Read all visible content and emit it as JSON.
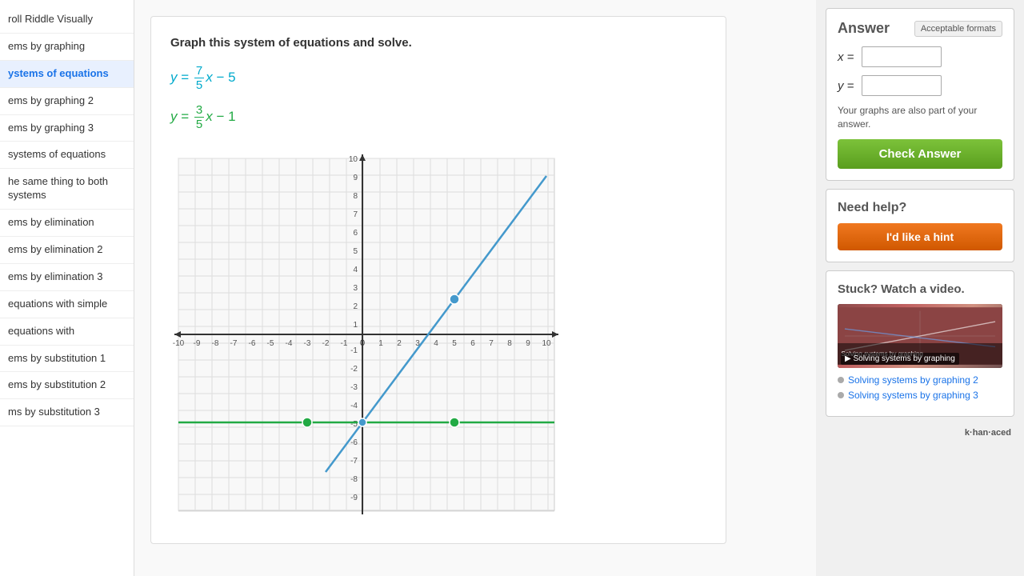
{
  "sidebar": {
    "items": [
      {
        "label": "roll Riddle Visually",
        "active": false
      },
      {
        "label": "ems by graphing",
        "active": false
      },
      {
        "label": "ystems of equations",
        "active": true
      },
      {
        "label": "ems by graphing 2",
        "active": false
      },
      {
        "label": "ems by graphing 3",
        "active": false
      },
      {
        "label": "systems of equations",
        "active": false
      },
      {
        "label": "he same thing to both systems",
        "active": false
      },
      {
        "label": "ems by elimination",
        "active": false
      },
      {
        "label": "ems by elimination 2",
        "active": false
      },
      {
        "label": "ems by elimination 3",
        "active": false
      },
      {
        "label": "equations with simple",
        "active": false
      },
      {
        "label": "equations with",
        "active": false
      },
      {
        "label": "ems by substitution 1",
        "active": false
      },
      {
        "label": "ems by substitution 2",
        "active": false
      },
      {
        "label": "ms by substitution 3",
        "active": false
      }
    ]
  },
  "problem": {
    "title": "Graph this system of equations and solve.",
    "eq1_prefix": "y =",
    "eq1_fraction_num": "7",
    "eq1_fraction_den": "5",
    "eq1_suffix": "x − 5",
    "eq2_prefix": "y =",
    "eq2_fraction_num": "3",
    "eq2_fraction_den": "5",
    "eq2_suffix": "x − 1"
  },
  "answer": {
    "title": "Answer",
    "acceptable_formats": "Acceptable formats",
    "x_label": "x =",
    "y_label": "y =",
    "note": "Your graphs are also part of your answer.",
    "check_button": "Check Answer"
  },
  "help": {
    "title": "Need help?",
    "hint_button": "I'd like a hint"
  },
  "video": {
    "title": "Stuck? Watch a video.",
    "video_label": "▶ Solving systems by graphing",
    "links": [
      {
        "text": "Solving systems by graphing 2"
      },
      {
        "text": "Solving systems by graphing 3"
      }
    ]
  },
  "khan_logo": "k·han·aced"
}
